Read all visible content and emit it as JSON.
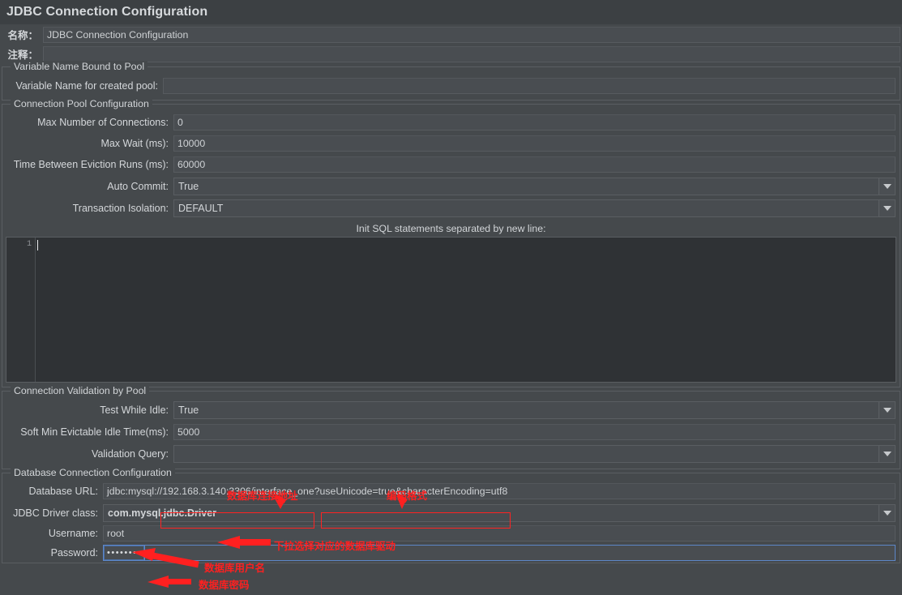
{
  "window": {
    "title": "JDBC Connection Configuration"
  },
  "meta": {
    "name_label": "名称：",
    "name_value": "JDBC Connection Configuration",
    "comment_label": "注释：",
    "comment_value": ""
  },
  "variable_group": {
    "title": "Variable Name Bound to Pool",
    "pool_name_label": "Variable Name for created pool:",
    "pool_name_value": ""
  },
  "pool_group": {
    "title": "Connection Pool Configuration",
    "rows": [
      {
        "label": "Max Number of Connections:",
        "value": "0",
        "type": "text"
      },
      {
        "label": "Max Wait (ms):",
        "value": "10000",
        "type": "text"
      },
      {
        "label": "Time Between Eviction Runs (ms):",
        "value": "60000",
        "type": "text"
      },
      {
        "label": "Auto Commit:",
        "value": "True",
        "type": "combo"
      },
      {
        "label": "Transaction Isolation:",
        "value": "DEFAULT",
        "type": "combo"
      }
    ],
    "sql_header": "Init SQL statements separated by new line:",
    "sql_line_number": "1",
    "sql_value": ""
  },
  "validation_group": {
    "title": "Connection Validation by Pool",
    "rows": [
      {
        "label": "Test While Idle:",
        "value": "True",
        "type": "combo"
      },
      {
        "label": "Soft Min Evictable Idle Time(ms):",
        "value": "5000",
        "type": "text"
      },
      {
        "label": "Validation Query:",
        "value": "",
        "type": "combo"
      }
    ]
  },
  "database_group": {
    "title": "Database Connection Configuration",
    "url_label": "Database URL:",
    "url_prefix": "jdbc:mysql://",
    "url_host": "192.168.3.140:3306/interface_one",
    "url_q": "?",
    "url_params": "useUnicode=true&characterEncoding=utf8",
    "driver_label": "JDBC Driver class:",
    "driver_value": "com.mysql.jdbc.Driver",
    "username_label": "Username:",
    "username_value": "root",
    "password_label": "Password:",
    "password_value": "••••••••"
  },
  "annotations": {
    "db_url_note": "数据库连接地址",
    "encoding_note": "编码格式",
    "driver_note": "下拉选择对应的数据库驱动",
    "username_note": "数据库用户名",
    "password_note": "数据库密码"
  },
  "colors": {
    "background": "#45494c",
    "titlebar": "#3c4043",
    "annotation_red": "#ff2020",
    "field_bg": "#494d51",
    "text": "#d2d5d8"
  }
}
